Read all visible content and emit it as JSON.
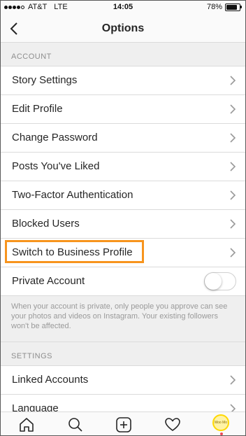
{
  "status_bar": {
    "carrier": "AT&T",
    "network": "LTE",
    "time": "14:05",
    "battery": "78%",
    "battery_level": 0.78,
    "signal_bars": 4
  },
  "nav": {
    "title": "Options",
    "back_icon": "chevron-left-icon"
  },
  "sections": {
    "account": {
      "header": "ACCOUNT",
      "items": [
        {
          "label": "Story Settings"
        },
        {
          "label": "Edit Profile"
        },
        {
          "label": "Change Password"
        },
        {
          "label": "Posts You've Liked"
        },
        {
          "label": "Two-Factor Authentication"
        },
        {
          "label": "Blocked Users"
        },
        {
          "label": "Switch to Business Profile",
          "highlighted": true
        },
        {
          "label": "Private Account",
          "toggle": false
        }
      ],
      "private_note": "When your account is private, only people you approve can see your photos and videos on Instagram. Your existing followers won't be affected."
    },
    "settings": {
      "header": "SETTINGS",
      "items": [
        {
          "label": "Linked Accounts"
        },
        {
          "label": "Language"
        }
      ]
    }
  },
  "tab_bar": {
    "icons": [
      "home-icon",
      "search-icon",
      "add-post-icon",
      "activity-heart-icon",
      "profile-avatar"
    ],
    "avatar_text": "Moo Mo"
  },
  "colors": {
    "highlight": "#f7941d",
    "background": "#efefef",
    "notification_dot": "#ed4956"
  }
}
